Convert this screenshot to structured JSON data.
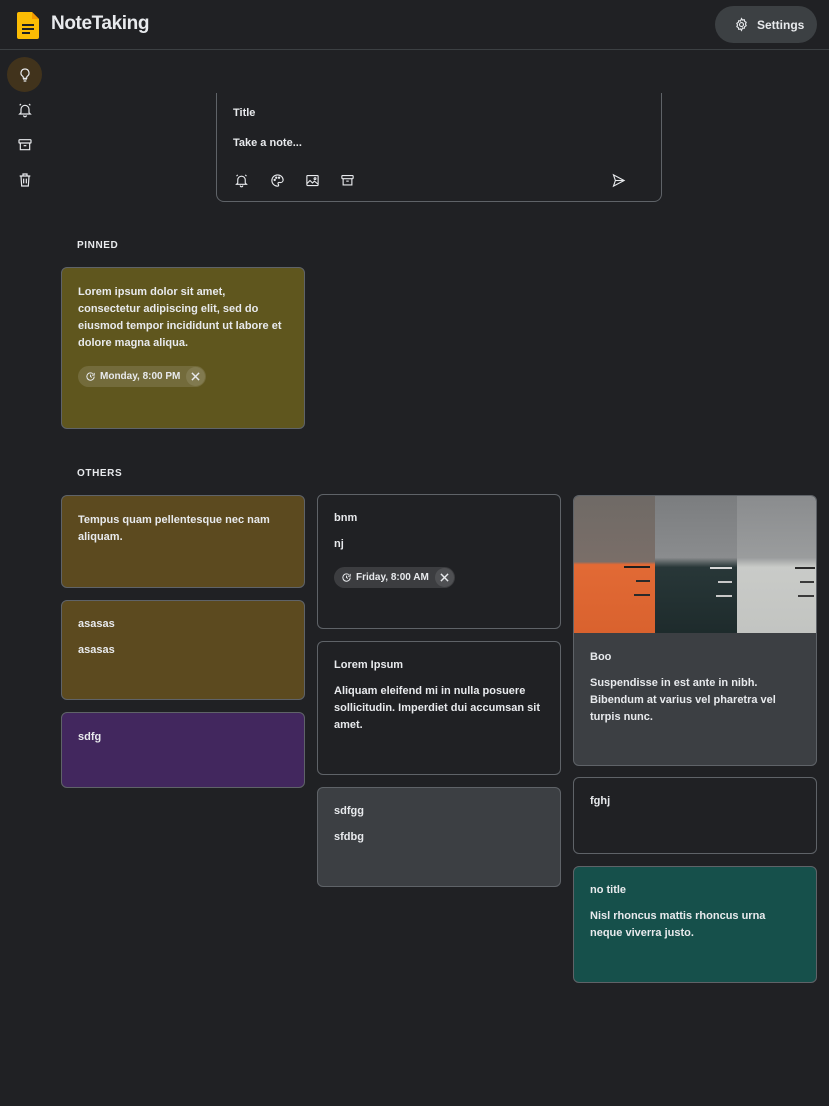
{
  "app": {
    "title": "NoteTaking",
    "settings_label": "Settings",
    "logo_color": "#fbbc04"
  },
  "sidebar": {
    "items": [
      {
        "name": "notes",
        "icon": "lightbulb-icon",
        "active": true
      },
      {
        "name": "reminders",
        "icon": "bell-icon",
        "active": false
      },
      {
        "name": "archive",
        "icon": "archive-icon",
        "active": false
      },
      {
        "name": "trash",
        "icon": "trash-icon",
        "active": false
      }
    ]
  },
  "composer": {
    "title_placeholder": "Title",
    "note_placeholder": "Take a note...",
    "actions": [
      "bell-icon",
      "palette-icon",
      "image-icon",
      "archive-icon"
    ],
    "submit": "send-icon"
  },
  "sections": {
    "pinned": "PINNED",
    "others": "OTHERS"
  },
  "pinned_notes": [
    {
      "title": "",
      "body": "Lorem ipsum dolor sit amet, consectetur adipiscing elit, sed do eiusmod tempor incididunt ut labore et dolore magna aliqua.",
      "reminder": "Monday, 8:00 PM",
      "color": "#5f561e"
    }
  ],
  "other_notes": {
    "col1": [
      {
        "title": "",
        "body": "Tempus quam pellentesque nec nam aliquam.",
        "color": "#5c4a1f"
      },
      {
        "title": "asasas",
        "body": "asasas",
        "color": "#5c4a1f"
      },
      {
        "title": "",
        "body": "sdfg",
        "color": "#42275e"
      }
    ],
    "col2": [
      {
        "title": "bnm",
        "body": "nj",
        "reminder": "Friday, 8:00 AM",
        "color": "#202124"
      },
      {
        "title": "Lorem Ipsum",
        "body": "Aliquam eleifend mi in nulla posuere sollicitudin. Imperdiet dui accumsan sit amet.",
        "color": "#202124"
      },
      {
        "title": "sdfgg",
        "body": "sfdbg",
        "color": "#3c3f43"
      }
    ],
    "col3": [
      {
        "title": "Boo",
        "body": "Suspendisse in est ante in nibh. Bibendum at varius vel pharetra vel turpis nunc.",
        "color": "#3c3f43",
        "has_image": true
      },
      {
        "title": "fghj",
        "body": "",
        "color": "#202124"
      },
      {
        "title": "no title",
        "body": "Nisl rhoncus mattis rhoncus urna neque viverra justo.",
        "color": "#16504b"
      }
    ]
  }
}
